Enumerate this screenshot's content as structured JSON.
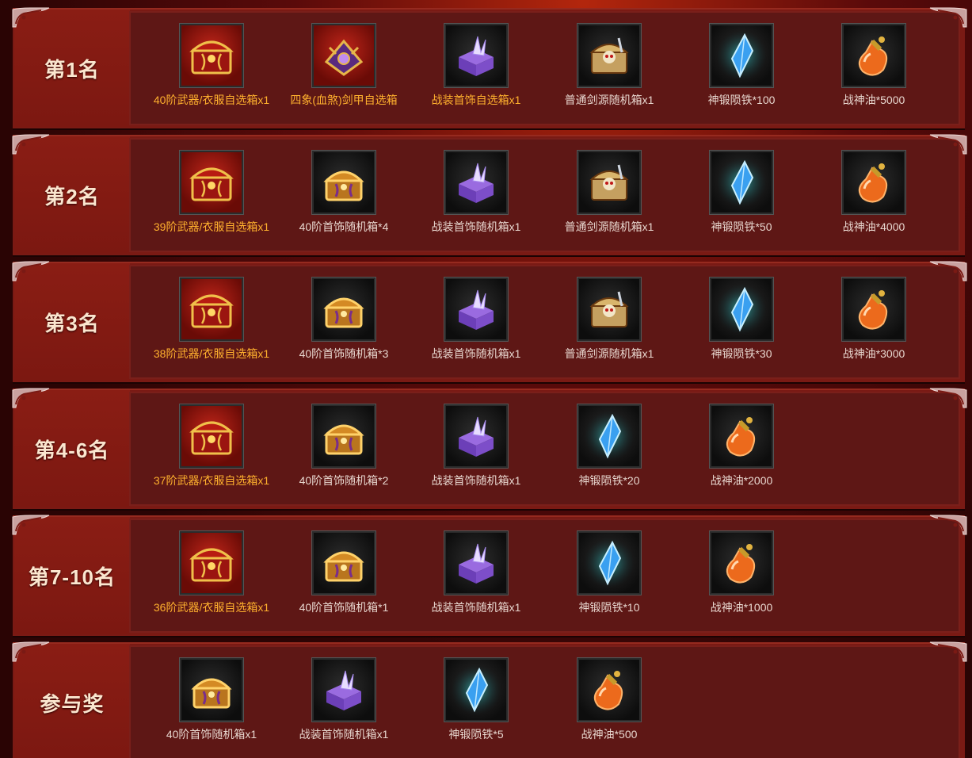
{
  "rows": [
    {
      "label": "第1名",
      "items": [
        {
          "name": "40阶武器/衣服自选箱x1",
          "icon": "red-gold-chest-icon",
          "highlight": true
        },
        {
          "name": "四象(血煞)剑甲自选箱",
          "icon": "purple-dragon-chest-icon",
          "highlight": true
        },
        {
          "name": "战装首饰自选箱x1",
          "icon": "purple-crystal-box-icon",
          "highlight": true
        },
        {
          "name": "普通剑源随机箱x1",
          "icon": "skull-chest-icon",
          "highlight": false
        },
        {
          "name": "神锻陨铁*100",
          "icon": "blue-crystal-icon",
          "highlight": false
        },
        {
          "name": "战神油*5000",
          "icon": "orange-potion-icon",
          "highlight": false
        }
      ]
    },
    {
      "label": "第2名",
      "items": [
        {
          "name": "39阶武器/衣服自选箱x1",
          "icon": "red-gold-chest-icon",
          "highlight": true
        },
        {
          "name": "40阶首饰随机箱*4",
          "icon": "gold-chest-icon",
          "highlight": false
        },
        {
          "name": "战装首饰随机箱x1",
          "icon": "purple-crystal-box-icon",
          "highlight": false
        },
        {
          "name": "普通剑源随机箱x1",
          "icon": "skull-chest-icon",
          "highlight": false
        },
        {
          "name": "神锻陨铁*50",
          "icon": "blue-crystal-icon",
          "highlight": false
        },
        {
          "name": "战神油*4000",
          "icon": "orange-potion-icon",
          "highlight": false
        }
      ]
    },
    {
      "label": "第3名",
      "items": [
        {
          "name": "38阶武器/衣服自选箱x1",
          "icon": "red-gold-chest-icon",
          "highlight": true
        },
        {
          "name": "40阶首饰随机箱*3",
          "icon": "gold-chest-icon",
          "highlight": false
        },
        {
          "name": "战装首饰随机箱x1",
          "icon": "purple-crystal-box-icon",
          "highlight": false
        },
        {
          "name": "普通剑源随机箱x1",
          "icon": "skull-chest-icon",
          "highlight": false
        },
        {
          "name": "神锻陨铁*30",
          "icon": "blue-crystal-icon",
          "highlight": false
        },
        {
          "name": "战神油*3000",
          "icon": "orange-potion-icon",
          "highlight": false
        }
      ]
    },
    {
      "label": "第4-6名",
      "items": [
        {
          "name": "37阶武器/衣服自选箱x1",
          "icon": "red-gold-chest-icon",
          "highlight": true
        },
        {
          "name": "40阶首饰随机箱*2",
          "icon": "gold-chest-icon",
          "highlight": false
        },
        {
          "name": "战装首饰随机箱x1",
          "icon": "purple-crystal-box-icon",
          "highlight": false
        },
        {
          "name": "神锻陨铁*20",
          "icon": "blue-crystal-icon",
          "highlight": false
        },
        {
          "name": "战神油*2000",
          "icon": "orange-potion-icon",
          "highlight": false
        }
      ]
    },
    {
      "label": "第7-10名",
      "items": [
        {
          "name": "36阶武器/衣服自选箱x1",
          "icon": "red-gold-chest-icon",
          "highlight": true
        },
        {
          "name": "40阶首饰随机箱*1",
          "icon": "gold-chest-icon",
          "highlight": false
        },
        {
          "name": "战装首饰随机箱x1",
          "icon": "purple-crystal-box-icon",
          "highlight": false
        },
        {
          "name": "神锻陨铁*10",
          "icon": "blue-crystal-icon",
          "highlight": false
        },
        {
          "name": "战神油*1000",
          "icon": "orange-potion-icon",
          "highlight": false
        }
      ]
    },
    {
      "label": "参与奖",
      "items": [
        {
          "name": "40阶首饰随机箱x1",
          "icon": "gold-chest-icon",
          "highlight": false
        },
        {
          "name": "战装首饰随机箱x1",
          "icon": "purple-crystal-box-icon",
          "highlight": false
        },
        {
          "name": "神锻陨铁*5",
          "icon": "blue-crystal-icon",
          "highlight": false
        },
        {
          "name": "战神油*500",
          "icon": "orange-potion-icon",
          "highlight": false
        }
      ]
    }
  ],
  "colors": {
    "highlight_text": "#ffb12e",
    "normal_text": "#e8d7cf",
    "row_bg": "#5e1715",
    "label_bg": "#8a1d14"
  }
}
